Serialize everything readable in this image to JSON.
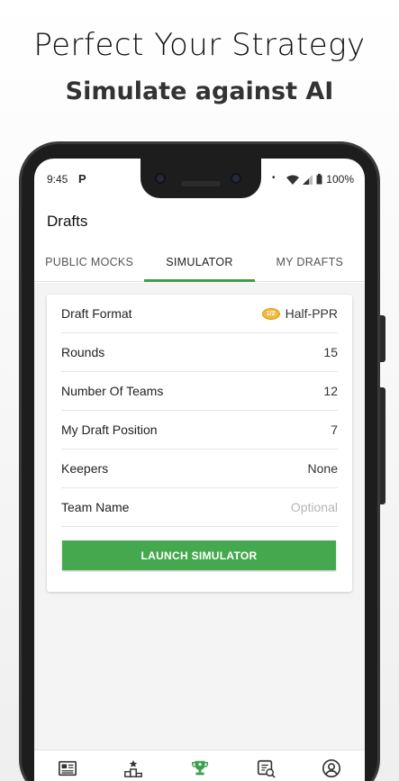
{
  "promo": {
    "title": "Perfect Your Strategy",
    "subtitle": "Simulate against AI"
  },
  "status_bar": {
    "time": "9:45",
    "app_icon": "P",
    "dot": "•",
    "battery": "100%"
  },
  "app": {
    "title": "Drafts"
  },
  "tabs": [
    {
      "label": "PUBLIC MOCKS",
      "active": false
    },
    {
      "label": "SIMULATOR",
      "active": true
    },
    {
      "label": "MY DRAFTS",
      "active": false
    }
  ],
  "settings": [
    {
      "label": "Draft Format",
      "value": "Half-PPR",
      "icon": "football-icon"
    },
    {
      "label": "Rounds",
      "value": "15"
    },
    {
      "label": "Number Of Teams",
      "value": "12"
    },
    {
      "label": "My Draft Position",
      "value": "7"
    },
    {
      "label": "Keepers",
      "value": "None"
    },
    {
      "label": "Team Name",
      "value": "",
      "placeholder": "Optional"
    }
  ],
  "football_badge": "1/2",
  "launch_button": "LAUNCH SIMULATOR",
  "bottom_nav": [
    {
      "icon": "newspaper-icon",
      "active": false
    },
    {
      "icon": "rankings-podium-icon",
      "active": false
    },
    {
      "icon": "trophy-icon",
      "active": true
    },
    {
      "icon": "draft-board-icon",
      "active": false
    },
    {
      "icon": "profile-icon",
      "active": false
    }
  ],
  "colors": {
    "accent": "#45a84f",
    "tab_indicator": "#3aa04a"
  }
}
